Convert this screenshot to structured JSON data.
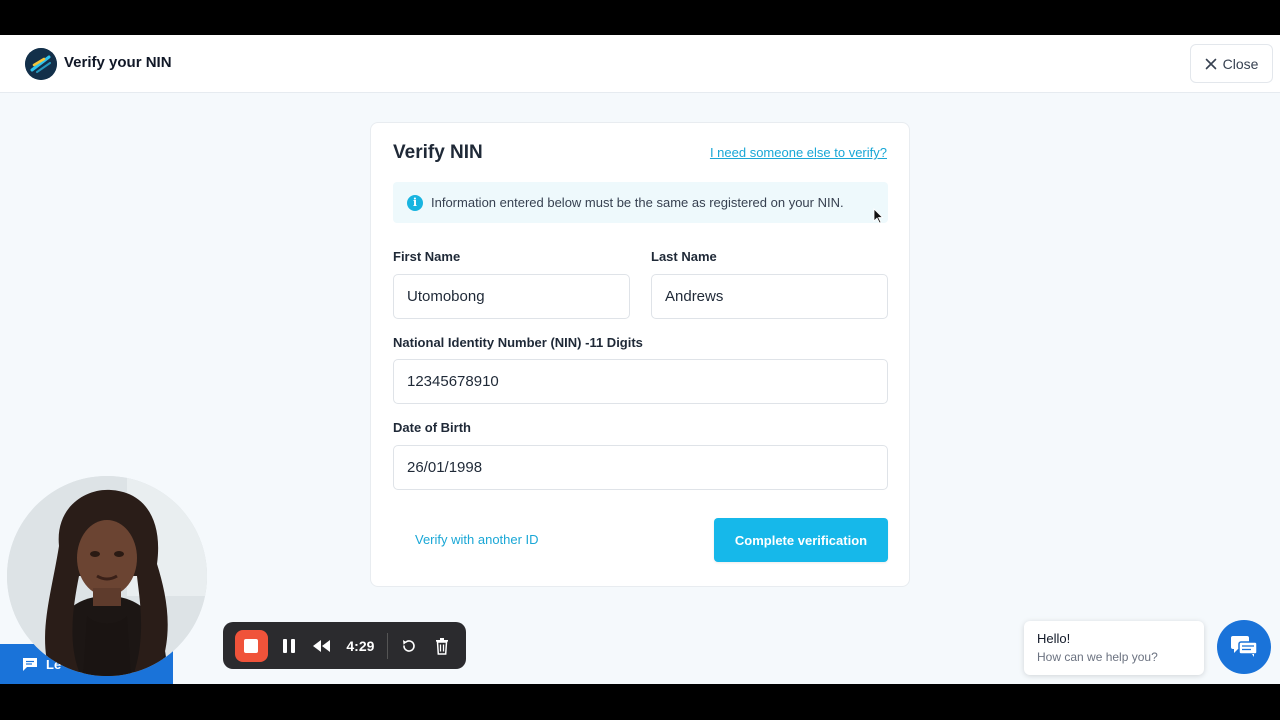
{
  "header": {
    "title": "Verify your NIN",
    "close_label": "Close"
  },
  "card": {
    "title": "Verify NIN",
    "help_link": "I need someone else to verify?",
    "info_text": "Information entered below must be the same as registered on your NIN.",
    "info_icon_glyph": "i",
    "fields": {
      "first_name": {
        "label": "First Name",
        "value": "Utomobong"
      },
      "last_name": {
        "label": "Last Name",
        "value": "Andrews"
      },
      "nin": {
        "label": "National Identity Number (NIN) -11 Digits",
        "value": "12345678910"
      },
      "dob": {
        "label": "Date of Birth",
        "value": "26/01/1998"
      }
    },
    "alt_link": "Verify with another ID",
    "submit_label": "Complete verification"
  },
  "chat": {
    "greeting": "Hello!",
    "prompt": "How can we help you?"
  },
  "lead_tab": {
    "label": "Le"
  },
  "recorder": {
    "time": "4:29"
  },
  "colors": {
    "accent": "#16b8ea",
    "link": "#1aa7d6",
    "chat_blue": "#1a73d9",
    "stop_red": "#f0533a"
  }
}
